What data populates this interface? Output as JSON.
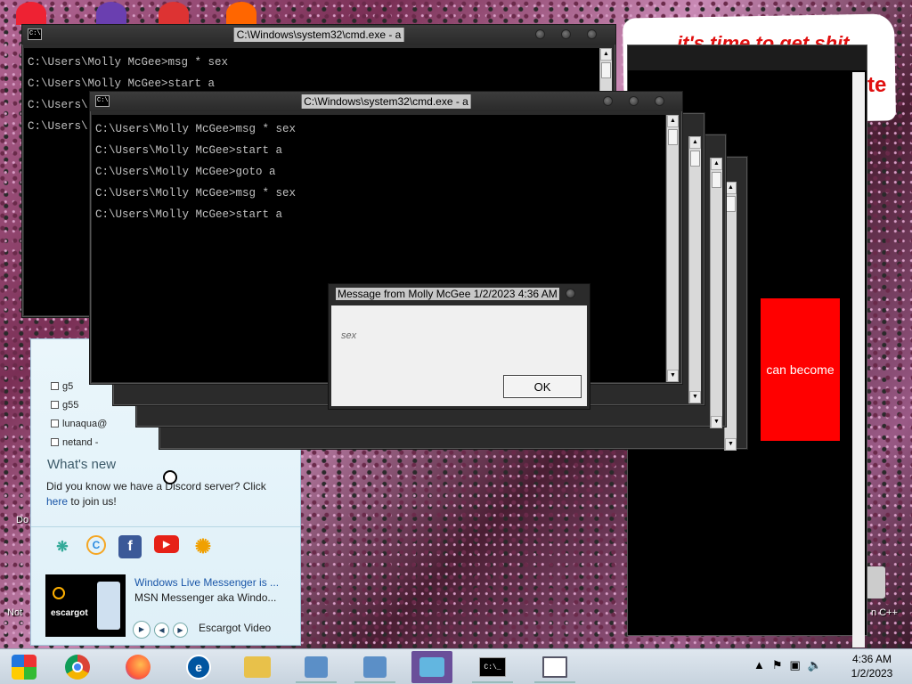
{
  "desktop": {
    "banner_text": "it's time to get shit",
    "banner_text2": "te",
    "icon_labels": [
      "Do",
      "Not",
      "n C++"
    ]
  },
  "cmd_back": {
    "title": "C:\\Windows\\system32\\cmd.exe - a",
    "lines": [
      "C:\\Users\\Molly McGee>msg * sex",
      "C:\\Users\\Molly McGee>start a",
      "C:\\Users\\",
      "C:\\Users\\"
    ]
  },
  "cmd_front": {
    "title": "C:\\Windows\\system32\\cmd.exe - a",
    "lines": [
      "C:\\Users\\Molly McGee>msg * sex",
      "C:\\Users\\Molly McGee>start a",
      "C:\\Users\\Molly McGee>goto a",
      "C:\\Users\\Molly McGee>msg * sex",
      "C:\\Users\\Molly McGee>start a"
    ]
  },
  "message_box": {
    "title": "Message from Molly McGee 1/2/2023 4:36 AM",
    "text": "sex",
    "ok_label": "OK"
  },
  "red_panel": {
    "text": "can become",
    "color": "#ff0000"
  },
  "msn": {
    "contacts": [
      "g5",
      "g55",
      "lunaqua@",
      "netand - "
    ],
    "whats_new_title": "What's new",
    "whats_new_text_before": "Did you know we have a Discord server? Click",
    "whats_new_link": "here",
    "whats_new_text_after": "to join us!",
    "social_icons": [
      "msn-butterfly-icon",
      "escargot-icon",
      "facebook-icon",
      "youtube-icon",
      "sun-icon"
    ],
    "news_title": "Windows Live Messenger is ...",
    "news_sub": "MSN Messenger aka Windo...",
    "thumb_label": "escargot",
    "media_label": "Escargot Video"
  },
  "taskbar": {
    "items": [
      {
        "name": "start-orb",
        "open": false
      },
      {
        "name": "chrome",
        "open": false
      },
      {
        "name": "firefox",
        "open": false
      },
      {
        "name": "msn-messenger",
        "open": false
      },
      {
        "name": "file-explorer",
        "open": false
      },
      {
        "name": "program-1",
        "open": true
      },
      {
        "name": "program-2",
        "open": true
      },
      {
        "name": "messenger-contacts",
        "open": true,
        "active": true
      },
      {
        "name": "cmd",
        "open": true
      },
      {
        "name": "window-app",
        "open": true
      }
    ],
    "time": "4:36 AM",
    "date": "1/2/2023"
  }
}
